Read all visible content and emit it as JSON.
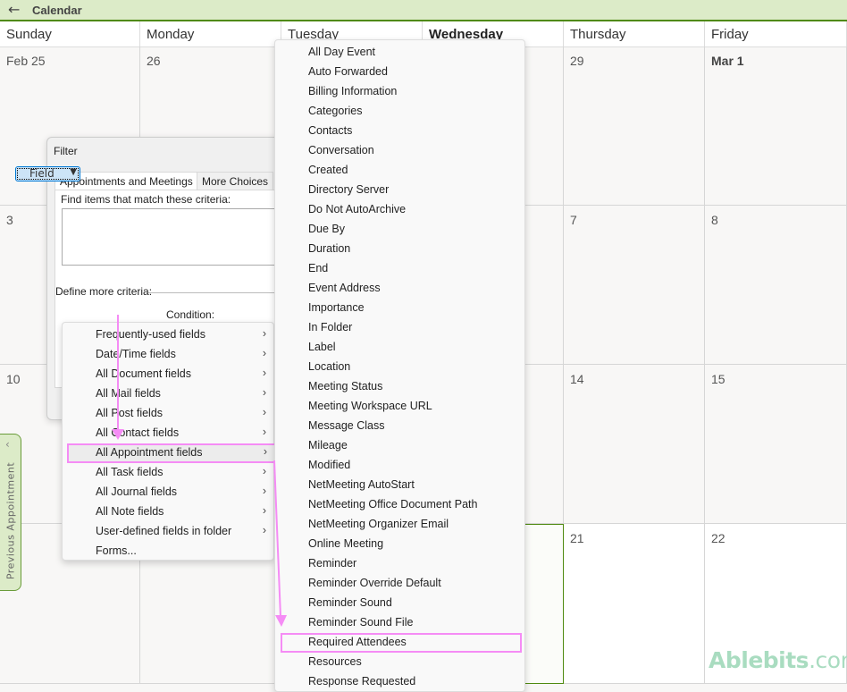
{
  "header": {
    "title": "Calendar",
    "back_icon": "arrow-left-icon"
  },
  "days": [
    "Sunday",
    "Monday",
    "Tuesday",
    "Wednesday",
    "Thursday",
    "Friday"
  ],
  "weeks": [
    [
      "Feb 25",
      "26",
      "",
      "",
      "29",
      "Mar 1"
    ],
    [
      "3",
      "",
      "",
      "",
      "7",
      "8"
    ],
    [
      "10",
      "",
      "",
      "",
      "14",
      "15"
    ],
    [
      "",
      "",
      "",
      "",
      "21",
      "22"
    ]
  ],
  "prev_appointment": "Previous Appointment",
  "dialog": {
    "title": "Filter",
    "tabs": [
      "Appointments and Meetings",
      "More Choices"
    ],
    "find_label": "Find items that match these criteria:",
    "define_label": "Define more criteria:",
    "field_button": "Field",
    "condition_label": "Condition:"
  },
  "field_menu": [
    "Frequently-used fields",
    "Date/Time fields",
    "All Document fields",
    "All Mail fields",
    "All Post fields",
    "All Contact fields",
    "All Appointment fields",
    "All Task fields",
    "All Journal fields",
    "All Note fields",
    "User-defined fields in folder",
    "Forms..."
  ],
  "field_menu_selected": "All Appointment fields",
  "appointment_fields": [
    "All Day Event",
    "Auto Forwarded",
    "Billing Information",
    "Categories",
    "Contacts",
    "Conversation",
    "Created",
    "Directory Server",
    "Do Not AutoArchive",
    "Due By",
    "Duration",
    "End",
    "Event Address",
    "Importance",
    "In Folder",
    "Label",
    "Location",
    "Meeting Status",
    "Meeting Workspace URL",
    "Message Class",
    "Mileage",
    "Modified",
    "NetMeeting AutoStart",
    "NetMeeting Office Document Path",
    "NetMeeting Organizer Email",
    "Online Meeting",
    "Reminder",
    "Reminder Override Default",
    "Reminder Sound",
    "Reminder Sound File",
    "Required Attendees",
    "Resources",
    "Response Requested"
  ],
  "appointment_field_selected": "Required Attendees",
  "colors": {
    "accent": "#4f8a10",
    "header_bg": "#dcebc8",
    "highlight": "#f58cf5"
  },
  "logo": {
    "brand": "Ablebits",
    ".tld": ".com"
  }
}
